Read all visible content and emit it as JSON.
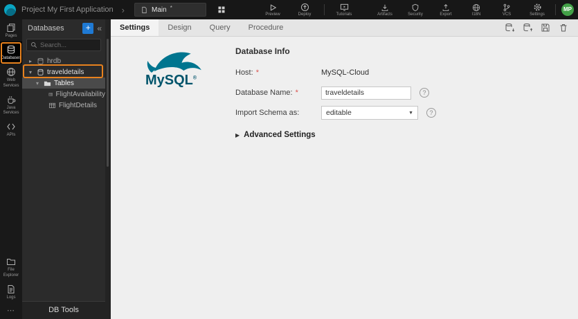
{
  "colors": {
    "accent_blue": "#1f7ad4",
    "annotation_orange": "#e8821e",
    "avatar_green": "#43a047",
    "mysql_blue": "#00546b",
    "mysql_teal": "#00758f",
    "required_red": "#d9534f"
  },
  "icons": {
    "project_chevron": "›",
    "collapse": "«",
    "add": "+",
    "tree_collapsed": "▸",
    "tree_expanded": "▾",
    "select_caret": "▼",
    "advanced_caret": "▶",
    "help": "?",
    "more": "⋯"
  },
  "topbar": {
    "project_label": "Project My First Application",
    "page_selector": {
      "value": "Main",
      "modified_mark": "*"
    },
    "preview_label": "Preview",
    "deploy_label": "Deploy",
    "tutorials_label": "Tutorials",
    "right_actions": [
      "Artifacts",
      "Security",
      "Export",
      "I18N",
      "VCS",
      "Settings"
    ],
    "avatar_initials": "MP"
  },
  "sidebar": {
    "items": [
      {
        "label": "Pages"
      },
      {
        "label": "Databases",
        "active": true
      },
      {
        "label": "Web Services"
      },
      {
        "label": "Java Services"
      },
      {
        "label": "APIs"
      },
      {
        "label": "File Explorer"
      },
      {
        "label": "Logs"
      }
    ]
  },
  "db_panel": {
    "title": "Databases",
    "search_placeholder": "Search...",
    "tree": {
      "hrdb": "hrdb",
      "traveldetails": "traveldetails",
      "tables_folder": "Tables",
      "table_items": [
        "FlightAvailability",
        "FlightDetails"
      ]
    },
    "footer_label": "DB Tools"
  },
  "main": {
    "tabs": [
      "Settings",
      "Design",
      "Query",
      "Procedure"
    ],
    "active_tab": "Settings",
    "section_title": "Database Info",
    "logo": {
      "brand": "MySQL",
      "registered": "®"
    },
    "fields": {
      "host": {
        "label": "Host:",
        "required": "*",
        "value": "MySQL-Cloud"
      },
      "database_name": {
        "label": "Database Name:",
        "required": "*",
        "value": "traveldetails"
      },
      "import_schema": {
        "label": "Import Schema as:",
        "value": "editable"
      }
    },
    "advanced_label": "Advanced Settings"
  }
}
